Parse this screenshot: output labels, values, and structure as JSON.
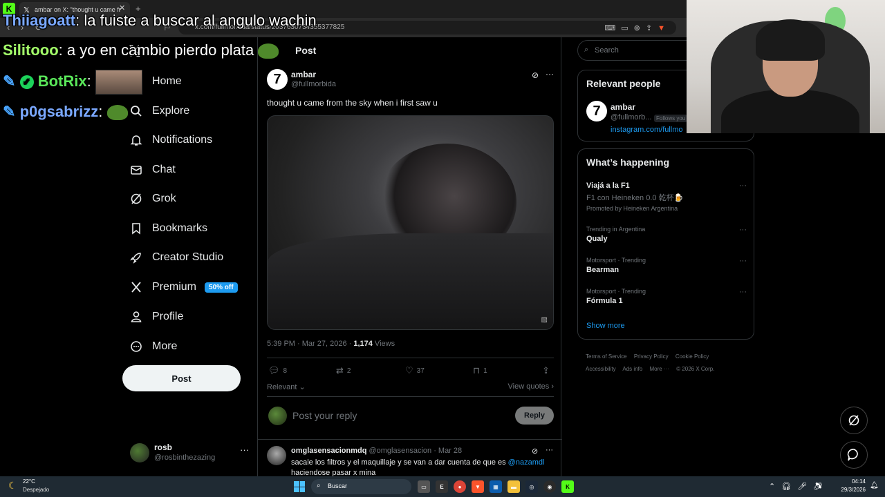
{
  "browser": {
    "tab_title": "ambar on X: \"thought u came fr",
    "url": "x.com/fullmorbida/status/2037630734355377825"
  },
  "nav": {
    "items": [
      {
        "label": "Home",
        "icon": "home-icon"
      },
      {
        "label": "Explore",
        "icon": "search-icon"
      },
      {
        "label": "Notifications",
        "icon": "bell-icon"
      },
      {
        "label": "Chat",
        "icon": "mail-icon"
      },
      {
        "label": "Grok",
        "icon": "grok-icon"
      },
      {
        "label": "Bookmarks",
        "icon": "bookmark-icon"
      },
      {
        "label": "Creator Studio",
        "icon": "rocket-icon"
      },
      {
        "label": "Premium",
        "icon": "x-icon"
      },
      {
        "label": "Profile",
        "icon": "person-icon"
      },
      {
        "label": "More",
        "icon": "more-circle-icon"
      }
    ],
    "premium_badge": "50% off",
    "post_button": "Post",
    "account": {
      "name": "rosb",
      "handle": "@rosbinthezazing"
    }
  },
  "main": {
    "header_title": "Post",
    "post": {
      "author_initial": "7",
      "author": "ambar",
      "handle": "@fullmorbida",
      "text": "thought u came from the sky when i first saw u",
      "time": "5:39 PM · Mar 27, 2026 · ",
      "views_count": "1,174",
      "views_label": " Views",
      "stats": {
        "replies": "8",
        "reposts": "2",
        "likes": "37",
        "bookmarks": "1"
      }
    },
    "sort_label": "Relevant ⌄",
    "view_quotes": "View quotes ›",
    "reply_placeholder": "Post your reply",
    "reply_button": "Reply",
    "comment": {
      "author": "omglasensacionmdq",
      "handle": "@omglasensacion",
      "date": " · Mar 28",
      "text_before": "sacale los filtros y el maquillaje y se van a dar cuenta de que es ",
      "mention": "@nazamdl",
      "text_after": "haciendose pasar x mina"
    }
  },
  "sidebar": {
    "search_placeholder": "Search",
    "relevant": {
      "title": "Relevant people",
      "initial": "7",
      "name": "ambar",
      "handle": "@fullmorb...",
      "follows_you": "Follows you",
      "link": "instagram.com/fullmo"
    },
    "happening": {
      "title": "What’s happening",
      "trends": [
        {
          "context": "",
          "title": "Viajá a la F1",
          "subtitle": "F1 con Heineken 0.0 乾杯🍺",
          "promo": "Promoted by Heineken Argentina"
        },
        {
          "context": "Trending in Argentina",
          "title": "Qualy"
        },
        {
          "context": "Motorsport · Trending",
          "title": "Bearman"
        },
        {
          "context": "Motorsport · Trending",
          "title": "Fórmula 1"
        }
      ],
      "show_more": "Show more"
    },
    "footer": [
      "Terms of Service",
      "Privacy Policy",
      "Cookie Policy",
      "Accessibility",
      "Ads info",
      "More ···",
      "© 2026 X Corp."
    ]
  },
  "chat": [
    {
      "user": "Thiiagoatt",
      "color": "#6fa3ff",
      "message": " la fuiste a buscar al angulo wachin"
    },
    {
      "user": "Silitooo",
      "color": "#9cff5a",
      "message": " a yo en cambio pierdo plata"
    },
    {
      "user": "BotRix",
      "color": "#4cff5a",
      "message": ""
    },
    {
      "user": "p0gsabrizz",
      "color": "#6fa3ff",
      "message": ""
    }
  ],
  "taskbar": {
    "temp": "22°C",
    "weather": "Despejado",
    "search": "Buscar",
    "time": "04:14",
    "date": "29/3/2026"
  }
}
